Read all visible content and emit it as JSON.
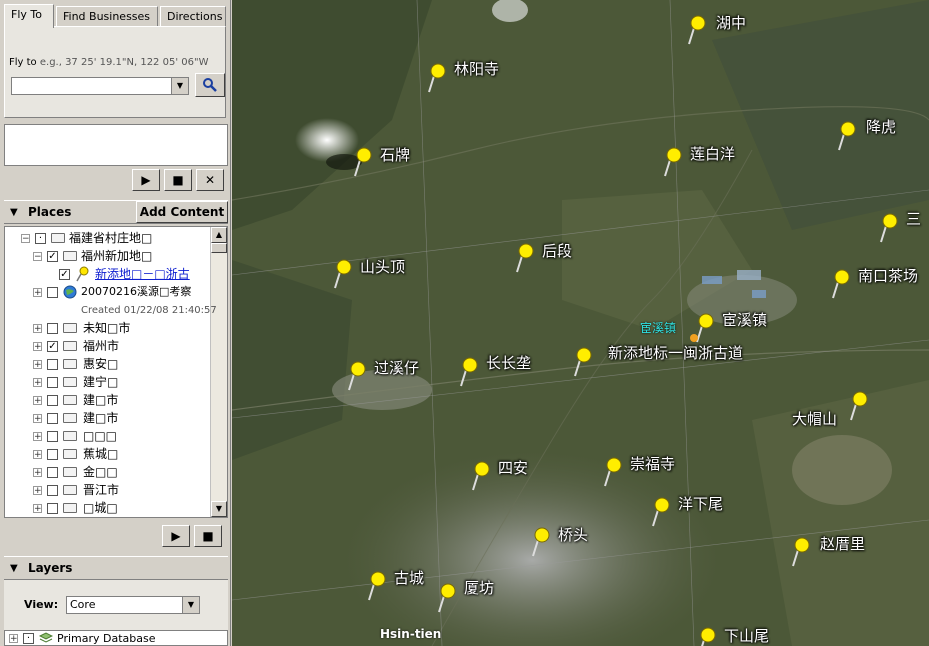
{
  "search": {
    "tabs": [
      "Fly To",
      "Find Businesses",
      "Directions"
    ],
    "flyto_label": "Fly to",
    "flyto_example": "e.g., 37 25' 19.1\"N, 122 05' 06\"W",
    "input_value": ""
  },
  "places": {
    "header": "Places",
    "add_content": "Add Content",
    "items": [
      {
        "label": "福建省村庄地□",
        "checked": false
      },
      {
        "label": "福州新加地□",
        "checked": true
      },
      {
        "label": "新添地□－□浙古",
        "checked": true
      },
      {
        "label": "20070216溪源□考察",
        "checked": false
      },
      {
        "label": "未知□市",
        "checked": false
      },
      {
        "label": "福州市",
        "checked": true
      },
      {
        "label": "惠安□",
        "checked": false
      },
      {
        "label": "建宁□",
        "checked": false
      },
      {
        "label": "建□市",
        "checked": false
      },
      {
        "label": "建□市",
        "checked": false
      },
      {
        "label": "□□□",
        "checked": false
      },
      {
        "label": "蕉城□",
        "checked": false
      },
      {
        "label": "金□□",
        "checked": false
      },
      {
        "label": "晋江市",
        "checked": false
      },
      {
        "label": "□城□",
        "checked": false
      }
    ],
    "created_text": "Created 01/22/08 21:40:57"
  },
  "layers": {
    "header": "Layers",
    "view_label": "View:",
    "view_value": "Core",
    "primary_db": "Primary Database"
  },
  "map": {
    "placemarks": [
      "湖中",
      "林阳寺",
      "石牌",
      "莲白洋",
      "降虎",
      "三",
      "后段",
      "山头顶",
      "南口茶场",
      "宦溪镇",
      "新添地标一闽浙古道",
      "过溪仔",
      "长长垄",
      "大帽山",
      "四安",
      "崇福寺",
      "洋下尾",
      "桥头",
      "赵厝里",
      "古城",
      "厦坊",
      "下山尾"
    ],
    "town_label": "宦溪镇",
    "hsin_label": "Hsin-tien"
  },
  "colors": {
    "panel": "#d4d0c8",
    "link": "#1020d0",
    "pin": "#ffee00"
  }
}
